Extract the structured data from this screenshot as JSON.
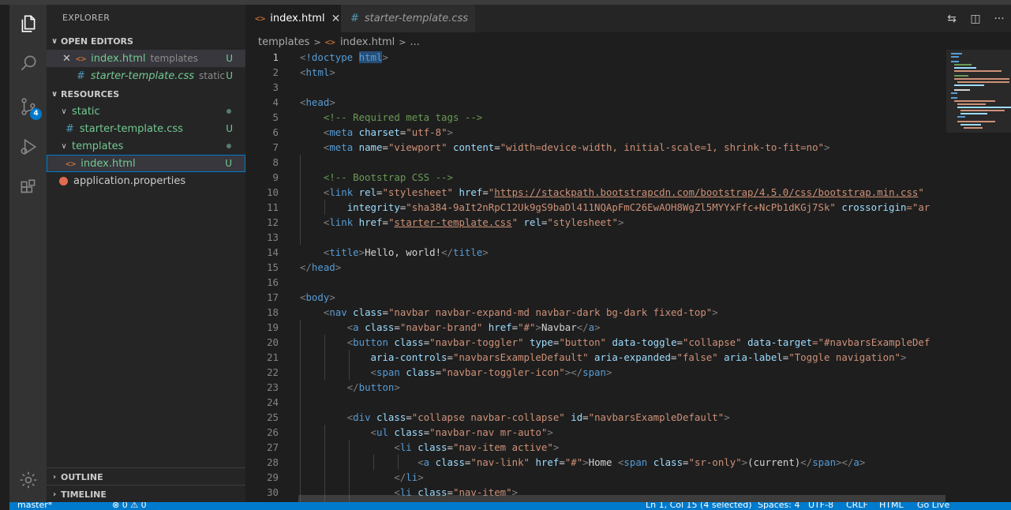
{
  "explorer": {
    "title": "EXPLORER",
    "open_editors_label": "OPEN EDITORS",
    "open_editors": [
      {
        "name": "index.html",
        "desc": "templates",
        "status": "U"
      },
      {
        "name": "starter-template.css",
        "desc": "static",
        "status": "U"
      }
    ],
    "project_label": "RESOURCES",
    "tree": {
      "static_folder": "static",
      "css_file": "starter-template.css",
      "css_status": "U",
      "templates_folder": "templates",
      "html_file": "index.html",
      "html_status": "U",
      "props_file": "application.properties"
    },
    "outline_label": "OUTLINE",
    "timeline_label": "TIMELINE"
  },
  "activity_bar": {
    "icons": [
      "files-icon",
      "search-icon",
      "source-control-icon",
      "run-debug-icon",
      "extensions-icon",
      "settings-gear-icon"
    ],
    "source_control_badge": "4"
  },
  "tabs": [
    {
      "label": "index.html",
      "active": true
    },
    {
      "label": "starter-template.css",
      "active": false
    }
  ],
  "breadcrumb": {
    "folder": "templates",
    "file": "index.html",
    "more": "..."
  },
  "code": {
    "current_line": 1,
    "lines": [
      "1",
      "2",
      "3",
      "4",
      "5",
      "6",
      "7",
      "8",
      "9",
      "10",
      "11",
      "12",
      "13",
      "14",
      "15",
      "16",
      "17",
      "18",
      "19",
      "20",
      "21",
      "22",
      "23",
      "24",
      "25",
      "26",
      "27",
      "28",
      "29",
      "30"
    ],
    "text": {
      "doctype": "!doctype",
      "html_sel": "html",
      "html": "html",
      "head": "head",
      "comment_meta": "<!-- Required meta tags -->",
      "meta": "meta",
      "charset": "charset",
      "charset_val": "\"utf-8\"",
      "name": "name",
      "viewport_val": "\"viewport\"",
      "content": "content",
      "content_val": "\"width=device-width, initial-scale=1, shrink-to-fit=no\"",
      "comment_bs": "<!-- Bootstrap CSS -->",
      "link": "link",
      "rel": "rel",
      "stylesheet_val": "\"stylesheet\"",
      "href": "href",
      "bs_url": "https://stackpath.bootstrapcdn.com/bootstrap/4.5.0/css/bootstrap.min.css",
      "integrity": "integrity",
      "integrity_val": "\"sha384-9aIt2nRpC12Uk9gS9baDl411NQApFmC26EwAOH8WgZl5MYYxFfc+NcPb1dKGj7Sk\"",
      "crossorigin": "crossorigin",
      "crossorigin_val": "=\"ar",
      "starter_css": "starter-template.css",
      "title": "title",
      "title_text": "Hello, world!",
      "body": "body",
      "nav": "nav",
      "class": "class",
      "nav_class_val": "\"navbar navbar-expand-md navbar-dark bg-dark fixed-top\"",
      "a": "a",
      "brand_class_val": "\"navbar-brand\"",
      "hash_val": "\"#\"",
      "navbar_text": "Navbar",
      "button": "button",
      "toggler_class_val": "\"navbar-toggler\"",
      "type": "type",
      "button_val": "\"button\"",
      "data_toggle": "data-toggle",
      "collapse_val": "\"collapse\"",
      "data_target": "data-target",
      "target_val": "=\"#navbarsExampleDef",
      "aria_controls": "aria-controls",
      "controls_val": "\"navbarsExampleDefault\"",
      "aria_expanded": "aria-expanded",
      "false_val": "\"false\"",
      "aria_label": "aria-label",
      "toggle_val": "\"Toggle navigation\"",
      "span": "span",
      "toggler_icon_val": "\"navbar-toggler-icon\"",
      "div": "div",
      "collapse_class_val": "\"collapse navbar-collapse\"",
      "id": "id",
      "id_val": "\"navbarsExampleDefault\"",
      "ul": "ul",
      "ul_class_val": "\"navbar-nav mr-auto\"",
      "li": "li",
      "li_active_val": "\"nav-item active\"",
      "navlink_val": "\"nav-link\"",
      "home_text": "Home ",
      "sronly_val": "\"sr-only\"",
      "current_text": "(current)",
      "li_item_val": "\"nav-item\""
    }
  },
  "colors": {
    "accent": "#007acc",
    "untracked_green": "#73c991",
    "tag_blue": "#569cd6",
    "attr_lightblue": "#9cdcfe",
    "string_orange": "#ce9178",
    "comment_green": "#6a9955"
  },
  "statusbar": {
    "branch": "master*",
    "problems": "⊗ 0  ⚠ 0",
    "position": "Ln 1, Col 15 (4 selected)",
    "spaces": "Spaces: 4",
    "encoding": "UTF-8",
    "eol": "CRLF",
    "language": "HTML",
    "golive": "Go Live"
  }
}
